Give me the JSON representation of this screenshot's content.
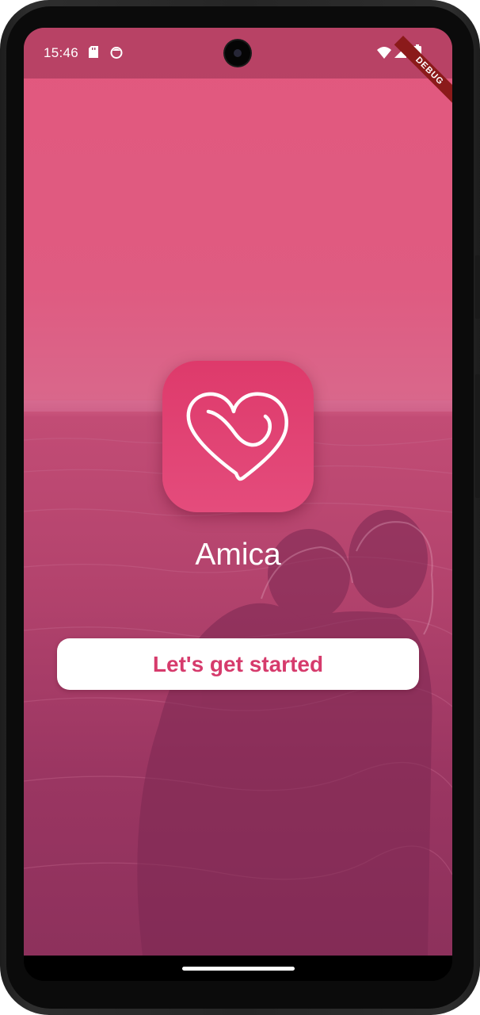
{
  "status_bar": {
    "time": "15:46",
    "left_icons": [
      "sd-card-icon",
      "face-icon"
    ],
    "right_icons": [
      "wifi-icon",
      "signal-icon",
      "battery-icon"
    ]
  },
  "debug_banner": "DEBUG",
  "app": {
    "icon": "heart-logo-icon",
    "name": "Amica"
  },
  "start_button": {
    "label": "Let's get started"
  },
  "colors": {
    "accent": "#d63b6c",
    "background_top": "#e2587e",
    "background_bottom": "#8d315c",
    "button_bg": "#ffffff"
  }
}
